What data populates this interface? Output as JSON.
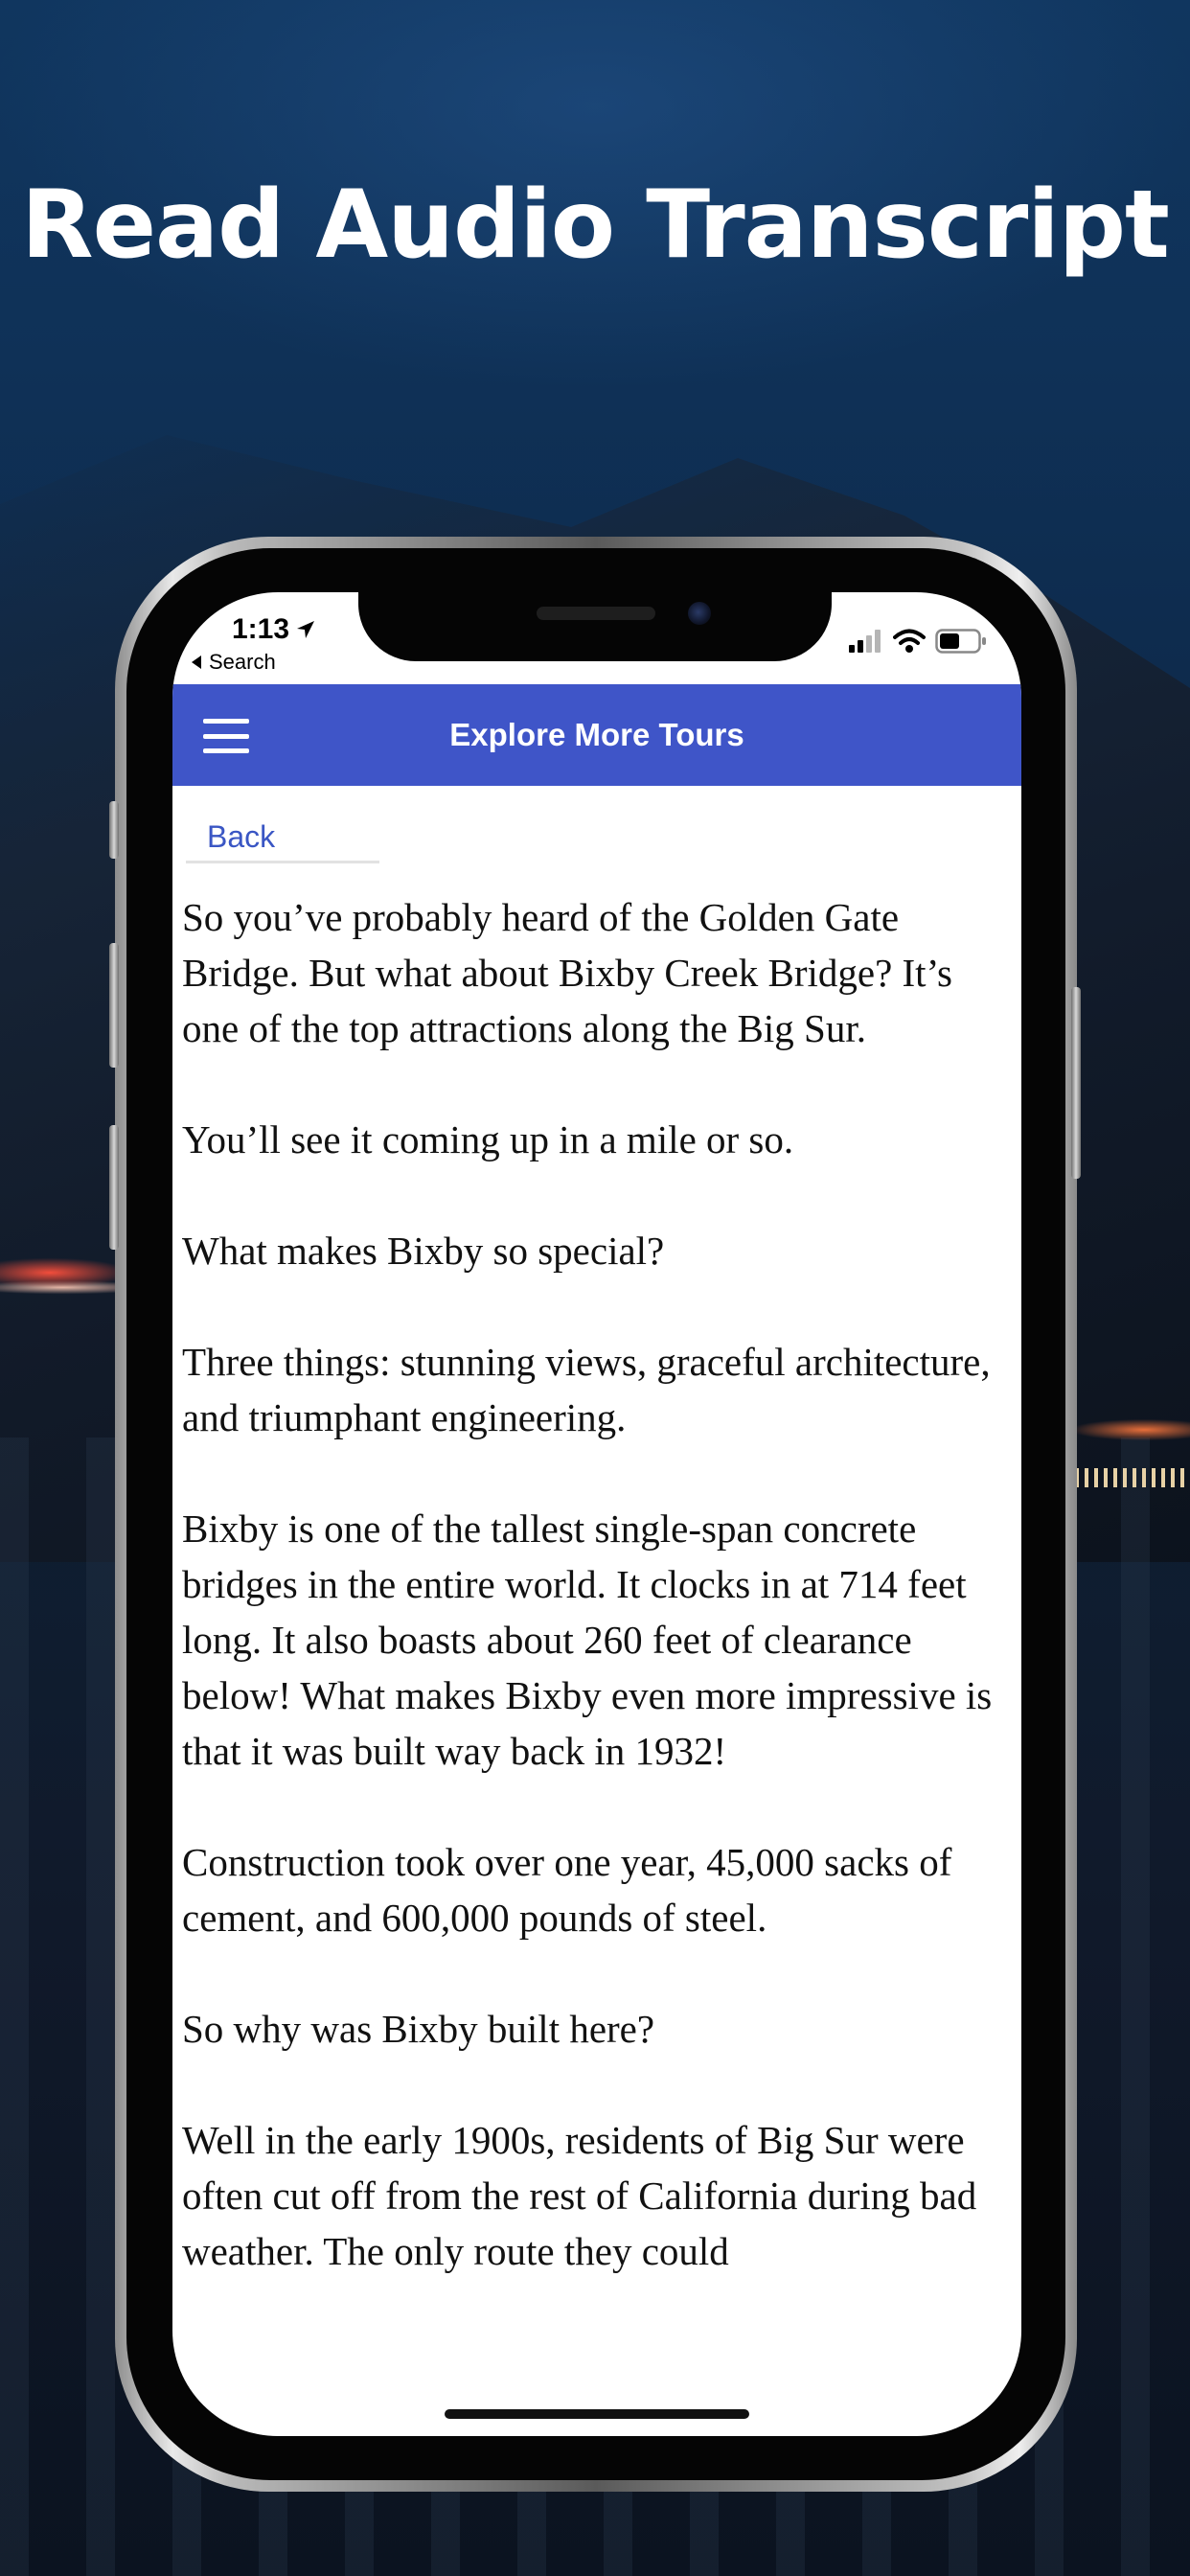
{
  "headline": "Read Audio Transcript",
  "status_bar": {
    "time": "1:13",
    "back_label": "Search"
  },
  "navbar": {
    "title": "Explore More Tours"
  },
  "back_link": "Back",
  "transcript": [
    "So you’ve probably heard of the Golden Gate Bridge. But what about Bixby Creek Bridge? It’s one of the top attractions along the Big Sur.",
    "You’ll see it coming up in a mile or so.",
    "What makes Bixby so special?",
    "Three things: stunning views, graceful architecture, and triumphant engineering.",
    "Bixby is one of the tallest single-span concrete bridges in the entire world. It clocks in at 714 feet long. It also boasts about 260 feet of clearance below! What makes Bixby even more impressive is that it was built way back in 1932!",
    "Construction took over one year, 45,000 sacks of cement, and 600,000 pounds of steel.",
    "So why was Bixby built here?",
    "Well in the early 1900s, residents of Big Sur were often cut off from the rest of California during bad weather. The only route they could"
  ],
  "colors": {
    "navbar": "#3f55c8",
    "link": "#3a56c4",
    "headline": "#ffffff"
  },
  "icons": {
    "menu": "hamburger-menu-icon",
    "location": "location-arrow-icon",
    "back": "back-triangle-icon",
    "signal": "cellular-signal-icon",
    "wifi": "wifi-icon",
    "battery": "battery-icon"
  }
}
